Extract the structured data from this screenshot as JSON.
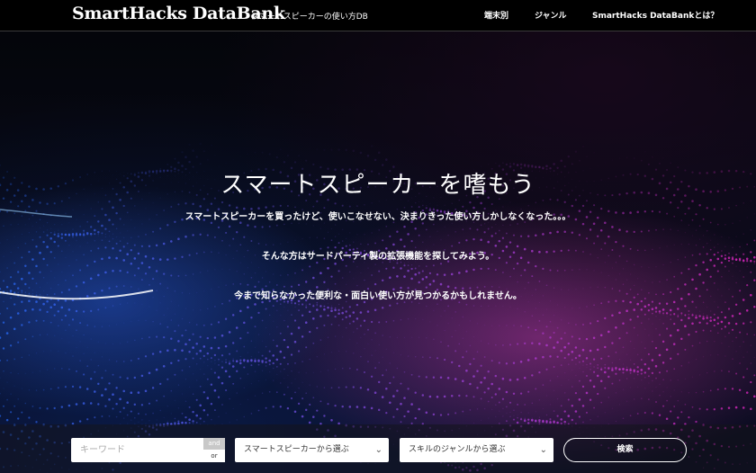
{
  "header": {
    "brand": "SmartHacks DataBank",
    "tagline": "スマートスピーカーの使い方DB",
    "nav": [
      {
        "label": "端末別"
      },
      {
        "label": "ジャンル"
      },
      {
        "label": "SmartHacks DataBankとは？"
      }
    ]
  },
  "hero": {
    "title": "スマートスピーカーを嗜もう",
    "lines": [
      "スマートスピーカーを買ったけど、使いこなせない、決まりきった使い方しかしなくなった。。。",
      "そんな方はサードパーティ製の拡張機能を探してみよう。",
      "今まで知らなかった便利な・面白い使い方が見つかるかもしれません。"
    ]
  },
  "search": {
    "keyword_placeholder": "キーワード",
    "toggle_and": "and",
    "toggle_or": "or",
    "speaker_select": "スマートスピーカーから選ぶ",
    "genre_select": "スキルのジャンルから選ぶ",
    "submit_label": "検索"
  }
}
